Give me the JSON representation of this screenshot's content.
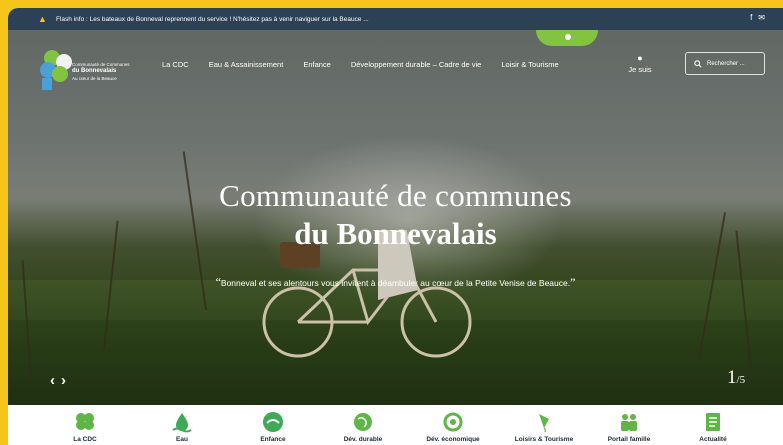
{
  "flash": {
    "message": "Flash info : Les bateaux de Bonneval reprennent du service ! N'hésitez pas à venir naviguer sur la Beauce ...",
    "social": [
      "f",
      "✉"
    ]
  },
  "logo": {
    "line1": "Communauté de Communes",
    "line2": "du Bonnevalais",
    "line3": "Au cœur de la Beauce"
  },
  "nav": {
    "items": [
      "La CDC",
      "Eau & Assainissement",
      "Enfance",
      "Développement durable – Cadre de vie",
      "Loisir & Tourisme"
    ],
    "account_label": "Je suis",
    "search_label": "Rechercher ..."
  },
  "hero": {
    "title_line1": "Communauté de communes",
    "title_line2": "du Bonnevalais",
    "quote": "Bonneval et ses alentours vous invitent à déambuler au cœur de la Petite Venise de Beauce.",
    "slide_current": "1",
    "slide_total": "5",
    "prev_arrow": "‹",
    "next_arrow": "›"
  },
  "quicklinks": [
    {
      "label": "La CDC",
      "icon": "clover-icon"
    },
    {
      "label": "Eau",
      "icon": "water-icon"
    },
    {
      "label": "Enfance",
      "icon": "child-icon"
    },
    {
      "label": "Dév. durable",
      "icon": "globe-icon"
    },
    {
      "label": "Dév. économique",
      "icon": "coin-icon"
    },
    {
      "label": "Loisirs & Tourisme",
      "icon": "kite-icon"
    },
    {
      "label": "Portail famille",
      "icon": "family-icon"
    },
    {
      "label": "Actualité",
      "icon": "news-icon"
    }
  ],
  "colors": {
    "brand_yellow": "#f6c51a",
    "flash_bg": "#2c4154",
    "accent_green": "#82c341"
  }
}
